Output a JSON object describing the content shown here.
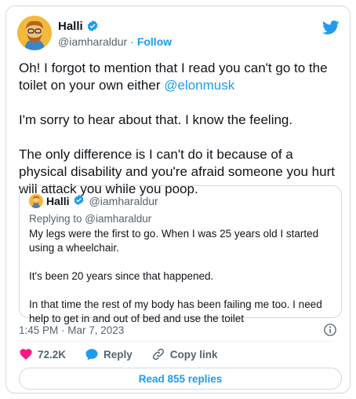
{
  "author": {
    "name": "Halli",
    "handle": "@iamharaldur",
    "separator": "·",
    "follow_label": "Follow"
  },
  "tweet": {
    "text_before_mention": "Oh! I forgot to mention that I read you can't go to the toilet on your own either ",
    "mention": "@elonmusk",
    "text_after_mention": "\n\nI'm sorry to hear about that. I know the feeling.\n\nThe only difference is I can't do it because of a physical disability and you're afraid someone you hurt will attack you while you poop."
  },
  "quoted": {
    "name": "Halli",
    "handle": "@iamharaldur",
    "replying_to": "Replying to @iamharaldur",
    "text": "My legs were the first to go. When I was 25 years old I started using a wheelchair.\n\nIt's been 20 years since that happened.\n\nIn that time the rest of my body has been failing me too. I need help to get in and out of bed and use the toilet"
  },
  "timestamp": "1:45 PM · Mar 7, 2023",
  "actions": {
    "likes": "72.2K",
    "reply_label": "Reply",
    "copy_link_label": "Copy link"
  },
  "read_replies_label": "Read 855 replies",
  "colors": {
    "accent": "#1d9bf0",
    "like": "#f91880",
    "muted": "#536471"
  },
  "icons": [
    "verified-badge-icon",
    "twitter-bird-icon",
    "info-icon",
    "heart-icon",
    "reply-bubble-icon",
    "link-icon"
  ]
}
